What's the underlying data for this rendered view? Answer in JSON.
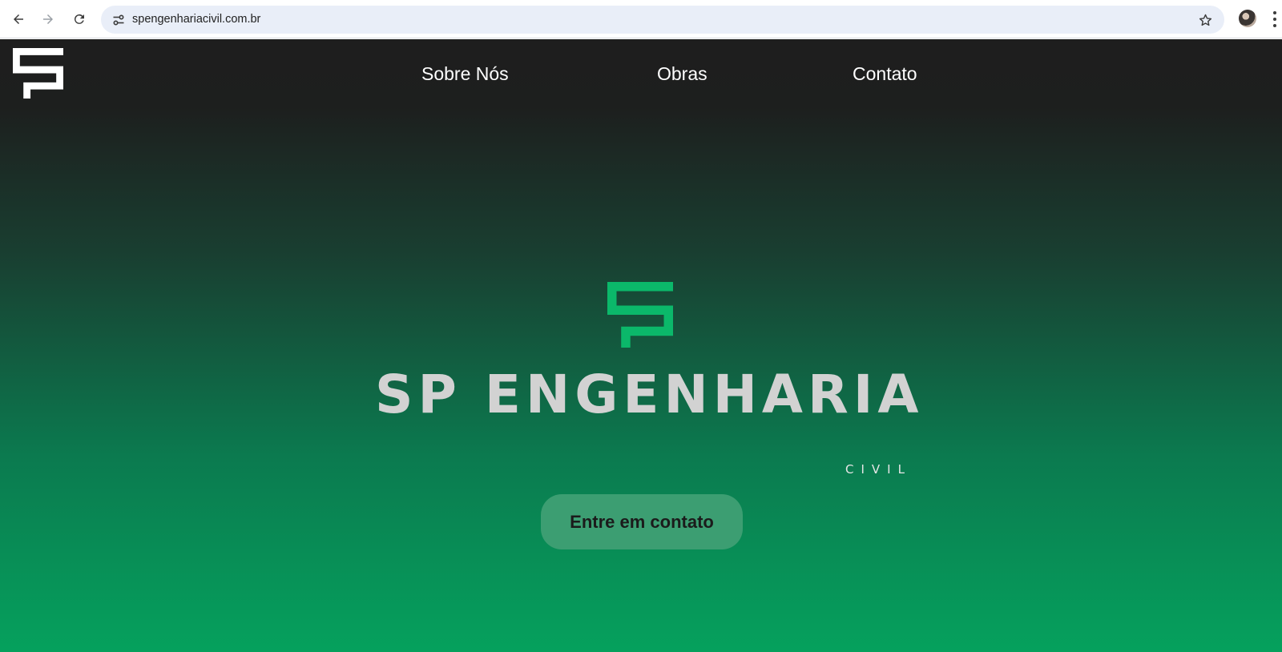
{
  "browser": {
    "url": "spengenhariacivil.com.br",
    "icons": {
      "back": "back-arrow-icon",
      "forward": "forward-arrow-icon",
      "reload": "reload-icon",
      "site_info": "site-info-icon",
      "bookmark": "star-icon",
      "profile": "profile-avatar",
      "menu": "kebab-menu-icon"
    }
  },
  "site": {
    "nav": {
      "items": [
        {
          "label": "Sobre Nós"
        },
        {
          "label": "Obras"
        },
        {
          "label": "Contato"
        }
      ]
    },
    "hero": {
      "title": "SP ENGENHARIA",
      "subtitle": "CIVIL",
      "cta_label": "Entre em contato"
    },
    "colors": {
      "brand_green": "#0bb86a",
      "header_dark": "#1e1e1e",
      "gradient_bottom": "#05a15d",
      "cta_background": "#3c9e72",
      "title_color": "#d2d2d2"
    }
  }
}
